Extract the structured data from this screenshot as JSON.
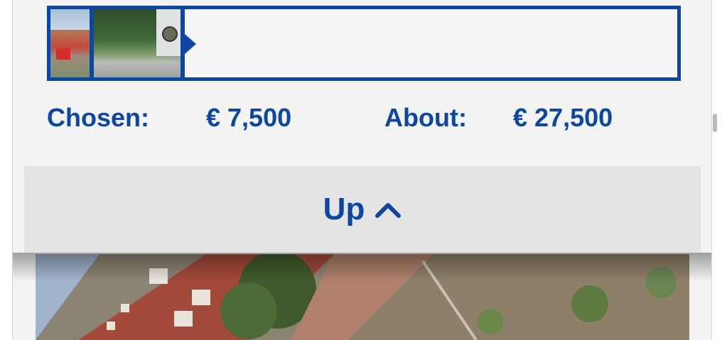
{
  "selection": {
    "chosen_label": "Chosen:",
    "chosen_value": "€ 7,500",
    "about_label": "About:",
    "about_value": "€ 27,500"
  },
  "up_button": {
    "label": "Up",
    "icon": "chevron-up-icon"
  },
  "colors": {
    "accent": "#0d47a1",
    "panel": "#f3f3f3",
    "button_bg": "#e4e4e4"
  }
}
